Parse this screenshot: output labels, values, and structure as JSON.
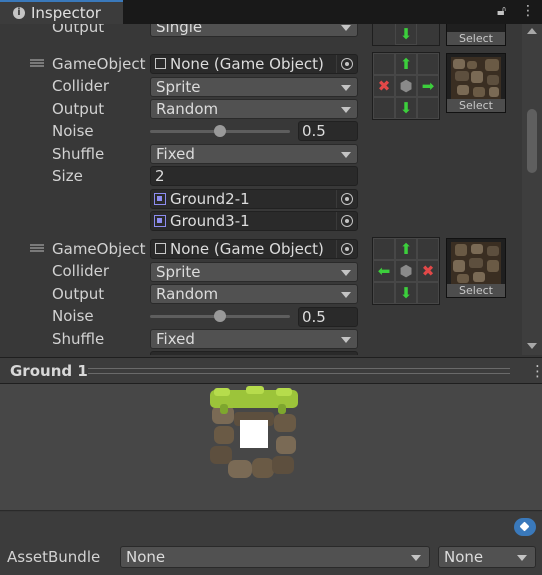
{
  "window": {
    "tab_label": "Inspector",
    "lock_icon": "lock-icon",
    "menu_icon": "kebab-menu-icon"
  },
  "rules": {
    "top_partial": {
      "output_label": "Output",
      "output_value": "Single",
      "select_label": "Select"
    },
    "rule1": {
      "gameobject_label": "GameObject",
      "gameobject_value": "None (Game Object)",
      "collider_label": "Collider",
      "collider_value": "Sprite",
      "output_label": "Output",
      "output_value": "Random",
      "noise_label": "Noise",
      "noise_value": "0.5",
      "noise_fraction": 0.5,
      "shuffle_label": "Shuffle",
      "shuffle_value": "Fixed",
      "size_label": "Size",
      "size_value": "2",
      "sprites": [
        "Ground2-1",
        "Ground3-1"
      ],
      "select_label": "Select",
      "neighbors": [
        "",
        "up-arrow",
        "",
        "x",
        "dot",
        "right-arrow",
        "",
        "down-arrow",
        ""
      ]
    },
    "rule2": {
      "gameobject_label": "GameObject",
      "gameobject_value": "None (Game Object)",
      "collider_label": "Collider",
      "collider_value": "Sprite",
      "output_label": "Output",
      "output_value": "Random",
      "noise_label": "Noise",
      "noise_value": "0.5",
      "noise_fraction": 0.5,
      "shuffle_label": "Shuffle",
      "shuffle_value": "Fixed",
      "select_label": "Select",
      "neighbors": [
        "",
        "up-arrow",
        "",
        "left-arrow",
        "dot",
        "x",
        "",
        "down-arrow",
        ""
      ]
    }
  },
  "preview": {
    "title": "Ground 1"
  },
  "footer": {
    "assetbundle_label": "AssetBundle",
    "assetbundle_value": "None",
    "variant_value": "None"
  },
  "colors": {
    "accent": "#3a79bb",
    "arrow_green": "#3ccf3c",
    "x_red": "#e24848"
  }
}
